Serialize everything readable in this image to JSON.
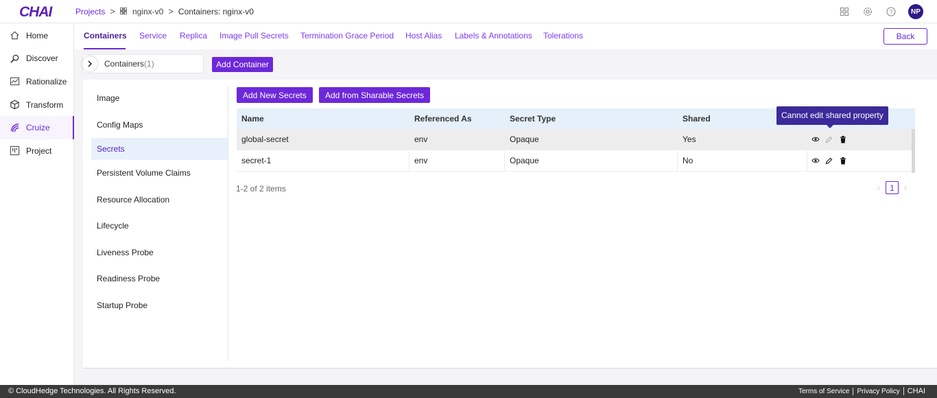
{
  "app": {
    "logo_text": "CHAI"
  },
  "breadcrumb": {
    "projects": "Projects",
    "app_name": "nginx-v0",
    "current": "Containers: nginx-v0"
  },
  "user": {
    "initials": "NP"
  },
  "sidebar": {
    "items": [
      {
        "label": "Home",
        "icon": "home-icon"
      },
      {
        "label": "Discover",
        "icon": "discover-icon"
      },
      {
        "label": "Rationalize",
        "icon": "rationalize-icon"
      },
      {
        "label": "Transform",
        "icon": "transform-icon"
      },
      {
        "label": "Cruize",
        "icon": "cruize-icon",
        "active": true
      },
      {
        "label": "Project",
        "icon": "project-icon"
      }
    ]
  },
  "tabs": [
    {
      "label": "Containers",
      "active": true
    },
    {
      "label": "Service"
    },
    {
      "label": "Replica"
    },
    {
      "label": "Image Pull Secrets"
    },
    {
      "label": "Termination Grace Period"
    },
    {
      "label": "Host Alias"
    },
    {
      "label": "Labels & Annotations"
    },
    {
      "label": "Tolerations"
    }
  ],
  "back_label": "Back",
  "containers": {
    "label": "Containers",
    "count": "(1)",
    "add_label": "Add Container"
  },
  "subnav": [
    {
      "label": "Image"
    },
    {
      "label": "Config Maps"
    },
    {
      "label": "Secrets",
      "active": true
    },
    {
      "label": "Persistent Volume Claims"
    },
    {
      "label": "Resource Allocation"
    },
    {
      "label": "Lifecycle"
    },
    {
      "label": "Liveness Probe"
    },
    {
      "label": "Readiness Probe"
    },
    {
      "label": "Startup Probe"
    }
  ],
  "secrets": {
    "add_new_label": "Add New Secrets",
    "add_sharable_label": "Add from Sharable Secrets",
    "columns": [
      "Name",
      "Referenced As",
      "Secret Type",
      "Shared",
      ""
    ],
    "rows": [
      {
        "name": "global-secret",
        "referenced_as": "env",
        "secret_type": "Opaque",
        "shared": "Yes"
      },
      {
        "name": "secret-1",
        "referenced_as": "env",
        "secret_type": "Opaque",
        "shared": "No"
      }
    ],
    "tooltip": "Cannot edit shared property",
    "items_count": "1-2 of 2 items",
    "current_page": "1"
  },
  "footer": {
    "copyright": "© CloudHedge Technologies. All Rights Reserved.",
    "terms": "Terms of Service",
    "privacy": "Privacy Policy",
    "brand": "CHAI"
  },
  "colors": {
    "accent": "#6d28d9",
    "tooltip_bg": "#3b2a9a",
    "table_header_bg": "#e6f0fa",
    "footer_bg": "#3a3a3a"
  }
}
